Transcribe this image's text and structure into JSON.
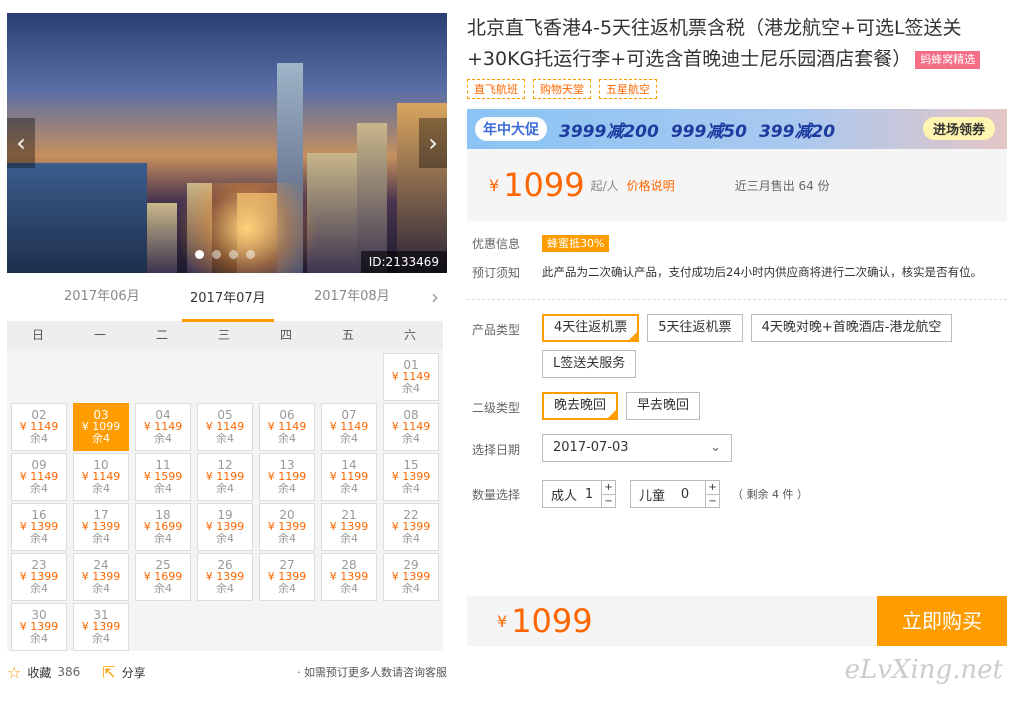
{
  "gallery": {
    "id_label": "ID:2133469"
  },
  "calendar": {
    "months": [
      "2017年06月",
      "2017年07月",
      "2017年08月"
    ],
    "active_month": 1,
    "weekdays": [
      "日",
      "一",
      "二",
      "三",
      "四",
      "五",
      "六"
    ],
    "leading_blanks": 6,
    "days": [
      {
        "day": "01",
        "price": "¥ 1149",
        "remain": "余4"
      },
      {
        "day": "02",
        "price": "¥ 1149",
        "remain": "余4"
      },
      {
        "day": "03",
        "price": "¥ 1099",
        "remain": "余4",
        "selected": true
      },
      {
        "day": "04",
        "price": "¥ 1149",
        "remain": "余4"
      },
      {
        "day": "05",
        "price": "¥ 1149",
        "remain": "余4"
      },
      {
        "day": "06",
        "price": "¥ 1149",
        "remain": "余4"
      },
      {
        "day": "07",
        "price": "¥ 1149",
        "remain": "余4"
      },
      {
        "day": "08",
        "price": "¥ 1149",
        "remain": "余4"
      },
      {
        "day": "09",
        "price": "¥ 1149",
        "remain": "余4"
      },
      {
        "day": "10",
        "price": "¥ 1149",
        "remain": "余4"
      },
      {
        "day": "11",
        "price": "¥ 1599",
        "remain": "余4"
      },
      {
        "day": "12",
        "price": "¥ 1199",
        "remain": "余4"
      },
      {
        "day": "13",
        "price": "¥ 1199",
        "remain": "余4"
      },
      {
        "day": "14",
        "price": "¥ 1199",
        "remain": "余4"
      },
      {
        "day": "15",
        "price": "¥ 1399",
        "remain": "余4"
      },
      {
        "day": "16",
        "price": "¥ 1399",
        "remain": "余4"
      },
      {
        "day": "17",
        "price": "¥ 1399",
        "remain": "余4"
      },
      {
        "day": "18",
        "price": "¥ 1699",
        "remain": "余4"
      },
      {
        "day": "19",
        "price": "¥ 1399",
        "remain": "余4"
      },
      {
        "day": "20",
        "price": "¥ 1399",
        "remain": "余4"
      },
      {
        "day": "21",
        "price": "¥ 1399",
        "remain": "余4"
      },
      {
        "day": "22",
        "price": "¥ 1399",
        "remain": "余4"
      },
      {
        "day": "23",
        "price": "¥ 1399",
        "remain": "余4"
      },
      {
        "day": "24",
        "price": "¥ 1399",
        "remain": "余4"
      },
      {
        "day": "25",
        "price": "¥ 1699",
        "remain": "余4"
      },
      {
        "day": "26",
        "price": "¥ 1399",
        "remain": "余4"
      },
      {
        "day": "27",
        "price": "¥ 1399",
        "remain": "余4"
      },
      {
        "day": "28",
        "price": "¥ 1399",
        "remain": "余4"
      },
      {
        "day": "29",
        "price": "¥ 1399",
        "remain": "余4"
      },
      {
        "day": "30",
        "price": "¥ 1399",
        "remain": "余4"
      },
      {
        "day": "31",
        "price": "¥ 1399",
        "remain": "余4"
      }
    ]
  },
  "bottom": {
    "fav_label": "收藏",
    "fav_count": "386",
    "share_label": "分享",
    "note": "· 如需预订更多人数请咨询客服"
  },
  "product": {
    "title": "北京直飞香港4-5天往返机票含税（港龙航空+可选L签送关+30KG托运行李+可选含首晚迪士尼乐园酒店套餐）",
    "badge": "蚂蜂窝精选",
    "tags": [
      "直飞航班",
      "购物天堂",
      "五星航空"
    ]
  },
  "banner": {
    "tag": "年中大促",
    "deals": [
      "3999减200",
      "999减50",
      "399减20"
    ],
    "button": "进场领券"
  },
  "price": {
    "yen": "¥",
    "amount": "1099",
    "unit": "起/人",
    "explain": "价格说明",
    "sold": "近三月售出 64 份"
  },
  "info": {
    "discount_label": "优惠信息",
    "discount_value": "蜂蜜抵30%",
    "notice_label": "预订须知",
    "notice_value": "此产品为二次确认产品，支付成功后24小时内供应商将进行二次确认，核实是否有位。"
  },
  "options": {
    "type_label": "产品类型",
    "types": [
      "4天往返机票",
      "5天往返机票",
      "4天晚对晚+首晚酒店-港龙航空",
      "L签送关服务"
    ],
    "type_selected": 0,
    "sub_label": "二级类型",
    "subs": [
      "晚去晚回",
      "早去晚回"
    ],
    "sub_selected": 0,
    "date_label": "选择日期",
    "date_value": "2017-07-03",
    "qty_label": "数量选择",
    "adult_label": "成人",
    "adult_count": "1",
    "child_label": "儿童",
    "child_count": "0",
    "remain": "（ 剩余 4 件 ）"
  },
  "buy": {
    "yen": "¥",
    "amount": "1099",
    "button": "立即购买"
  },
  "watermark": "eLvXing.net"
}
